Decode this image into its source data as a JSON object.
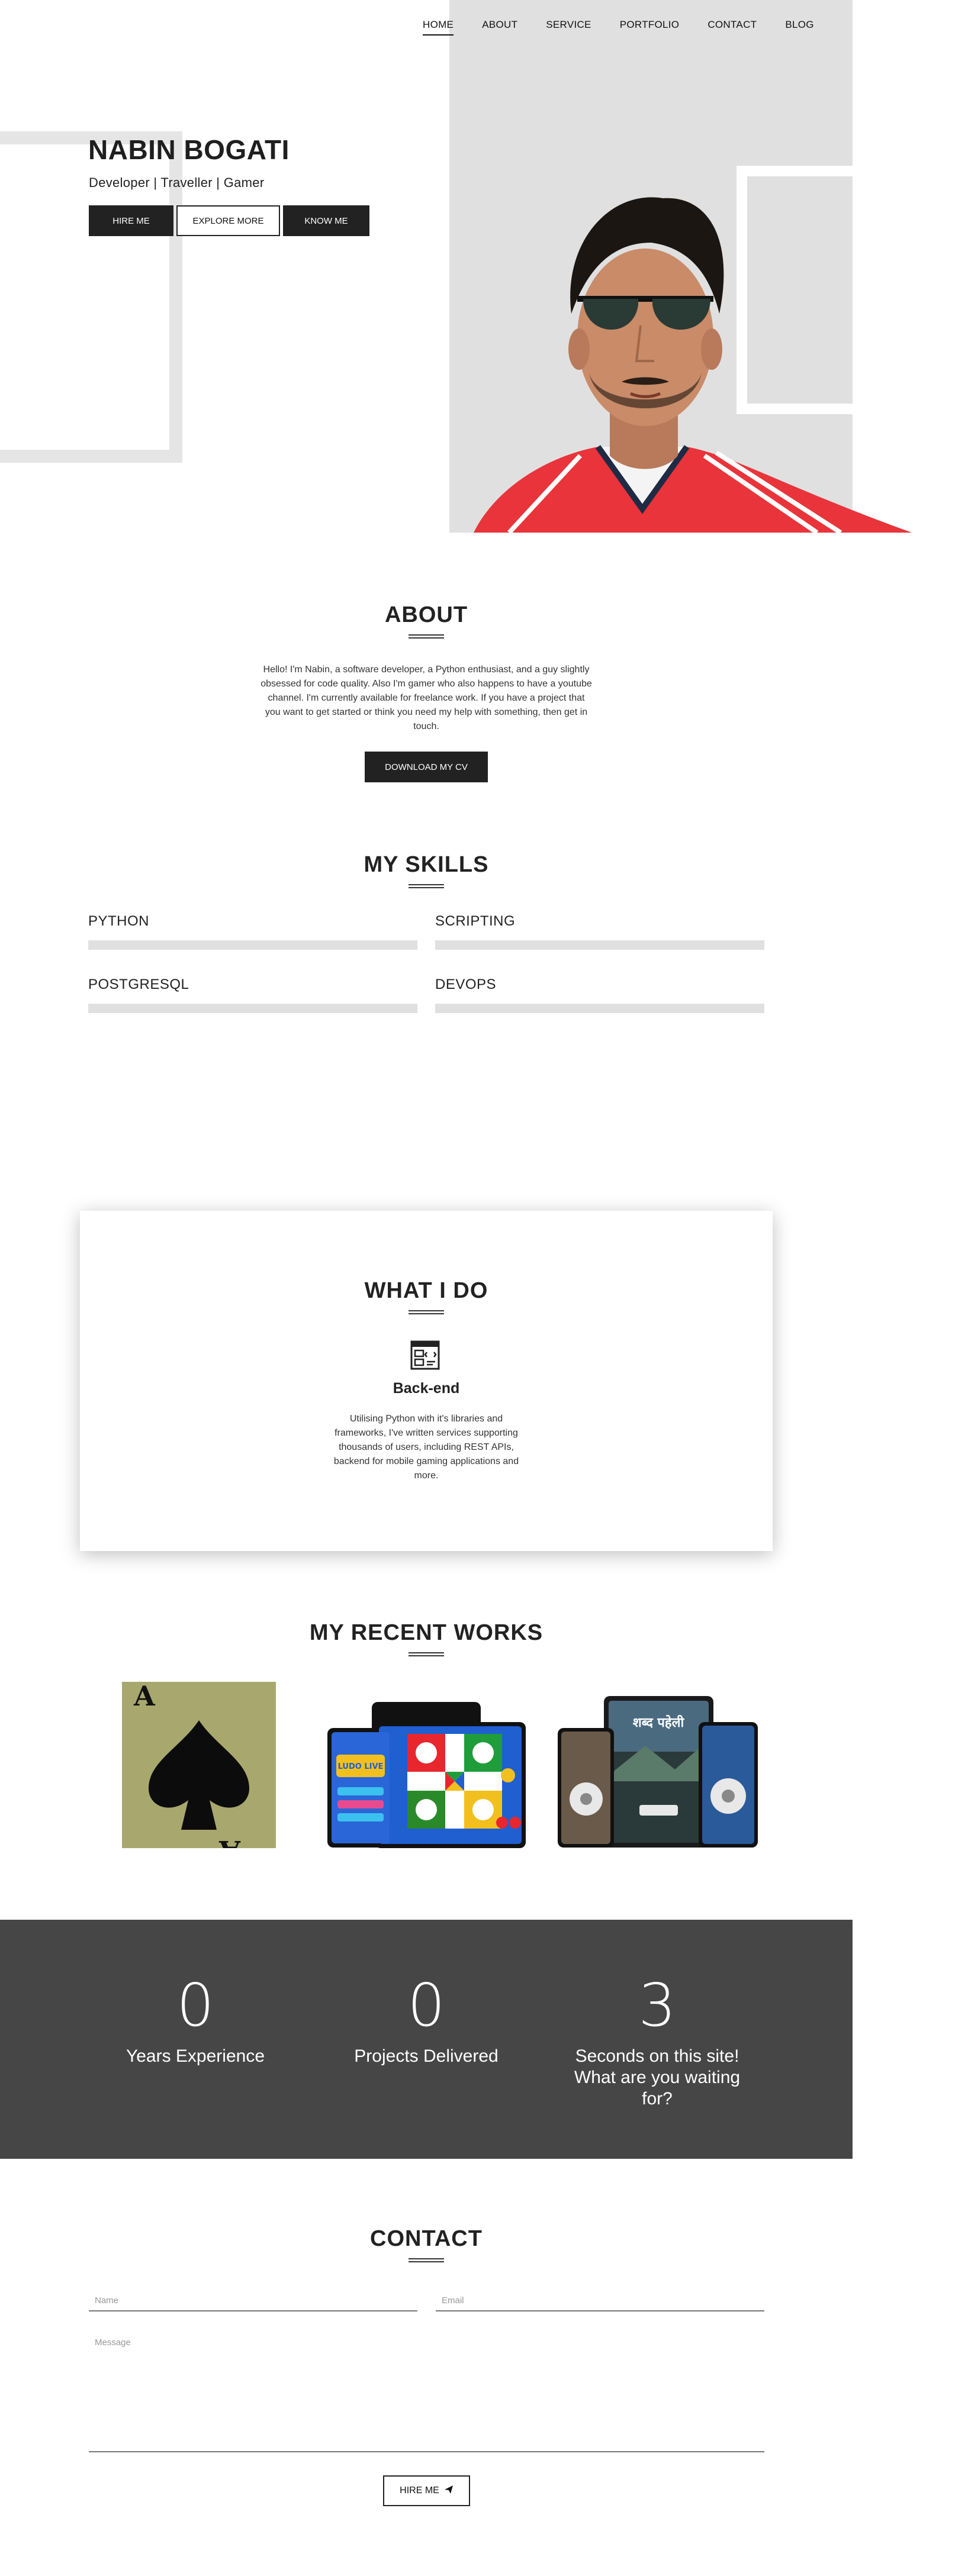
{
  "nav": {
    "items": [
      {
        "label": "HOME",
        "active": true
      },
      {
        "label": "ABOUT",
        "active": false
      },
      {
        "label": "SERVICE",
        "active": false
      },
      {
        "label": "PORTFOLIO",
        "active": false
      },
      {
        "label": "CONTACT",
        "active": false
      },
      {
        "label": "BLOG",
        "active": false
      }
    ]
  },
  "hero": {
    "name": "NABIN BOGATI",
    "subtitle": "Developer | Traveller | Gamer",
    "buttons": [
      "HIRE ME",
      "EXPLORE MORE",
      "KNOW ME"
    ]
  },
  "about": {
    "title": "ABOUT",
    "text": "Hello! I'm Nabin, a software developer, a Python enthusiast, and a guy slightly obsessed for code quality. Also I'm gamer who also happens to have a youtube channel. I'm currently available for freelance work. If you have a project that you want to get started or think you need my help with something, then get in touch.",
    "button": "DOWNLOAD MY CV"
  },
  "skills": {
    "title": "MY SKILLS",
    "items": [
      {
        "label": "PYTHON",
        "level": 0
      },
      {
        "label": "SCRIPTING",
        "level": 0
      },
      {
        "label": "POSTGRESQL",
        "level": 0
      },
      {
        "label": "DEVOPS",
        "level": 0
      }
    ]
  },
  "what_i_do": {
    "title": "WHAT I DO",
    "icon": "code-window-icon",
    "heading": "Back-end",
    "text": "Utilising Python with it's libraries and frameworks, I've written services supporting thousands of users, including REST APIs, backend for mobile gaming applications and more."
  },
  "works": {
    "title": "MY RECENT WORKS",
    "items": [
      {
        "name": "ace-of-spades-card",
        "card_text": "A"
      },
      {
        "name": "ludo-game-devices",
        "logo_text": "LUDO LIVE"
      },
      {
        "name": "word-puzzle-devices",
        "app_title": "शब्द पहेली"
      }
    ]
  },
  "stats": {
    "items": [
      {
        "value": "0",
        "label": "Years Experience"
      },
      {
        "value": "0",
        "label": "Projects Delivered"
      },
      {
        "value": "3",
        "label": "Seconds on this site! What are you waiting for?"
      }
    ]
  },
  "contact": {
    "title": "CONTACT",
    "name_placeholder": "Name",
    "email_placeholder": "Email",
    "message_placeholder": "Message",
    "button": "HIRE ME"
  },
  "colors": {
    "dark": "#222222",
    "hero_grey": "#e0e0e0",
    "stats_bg": "#464646",
    "card_olive": "#a8a86e",
    "ludo_blue": "#1f5fd0"
  }
}
